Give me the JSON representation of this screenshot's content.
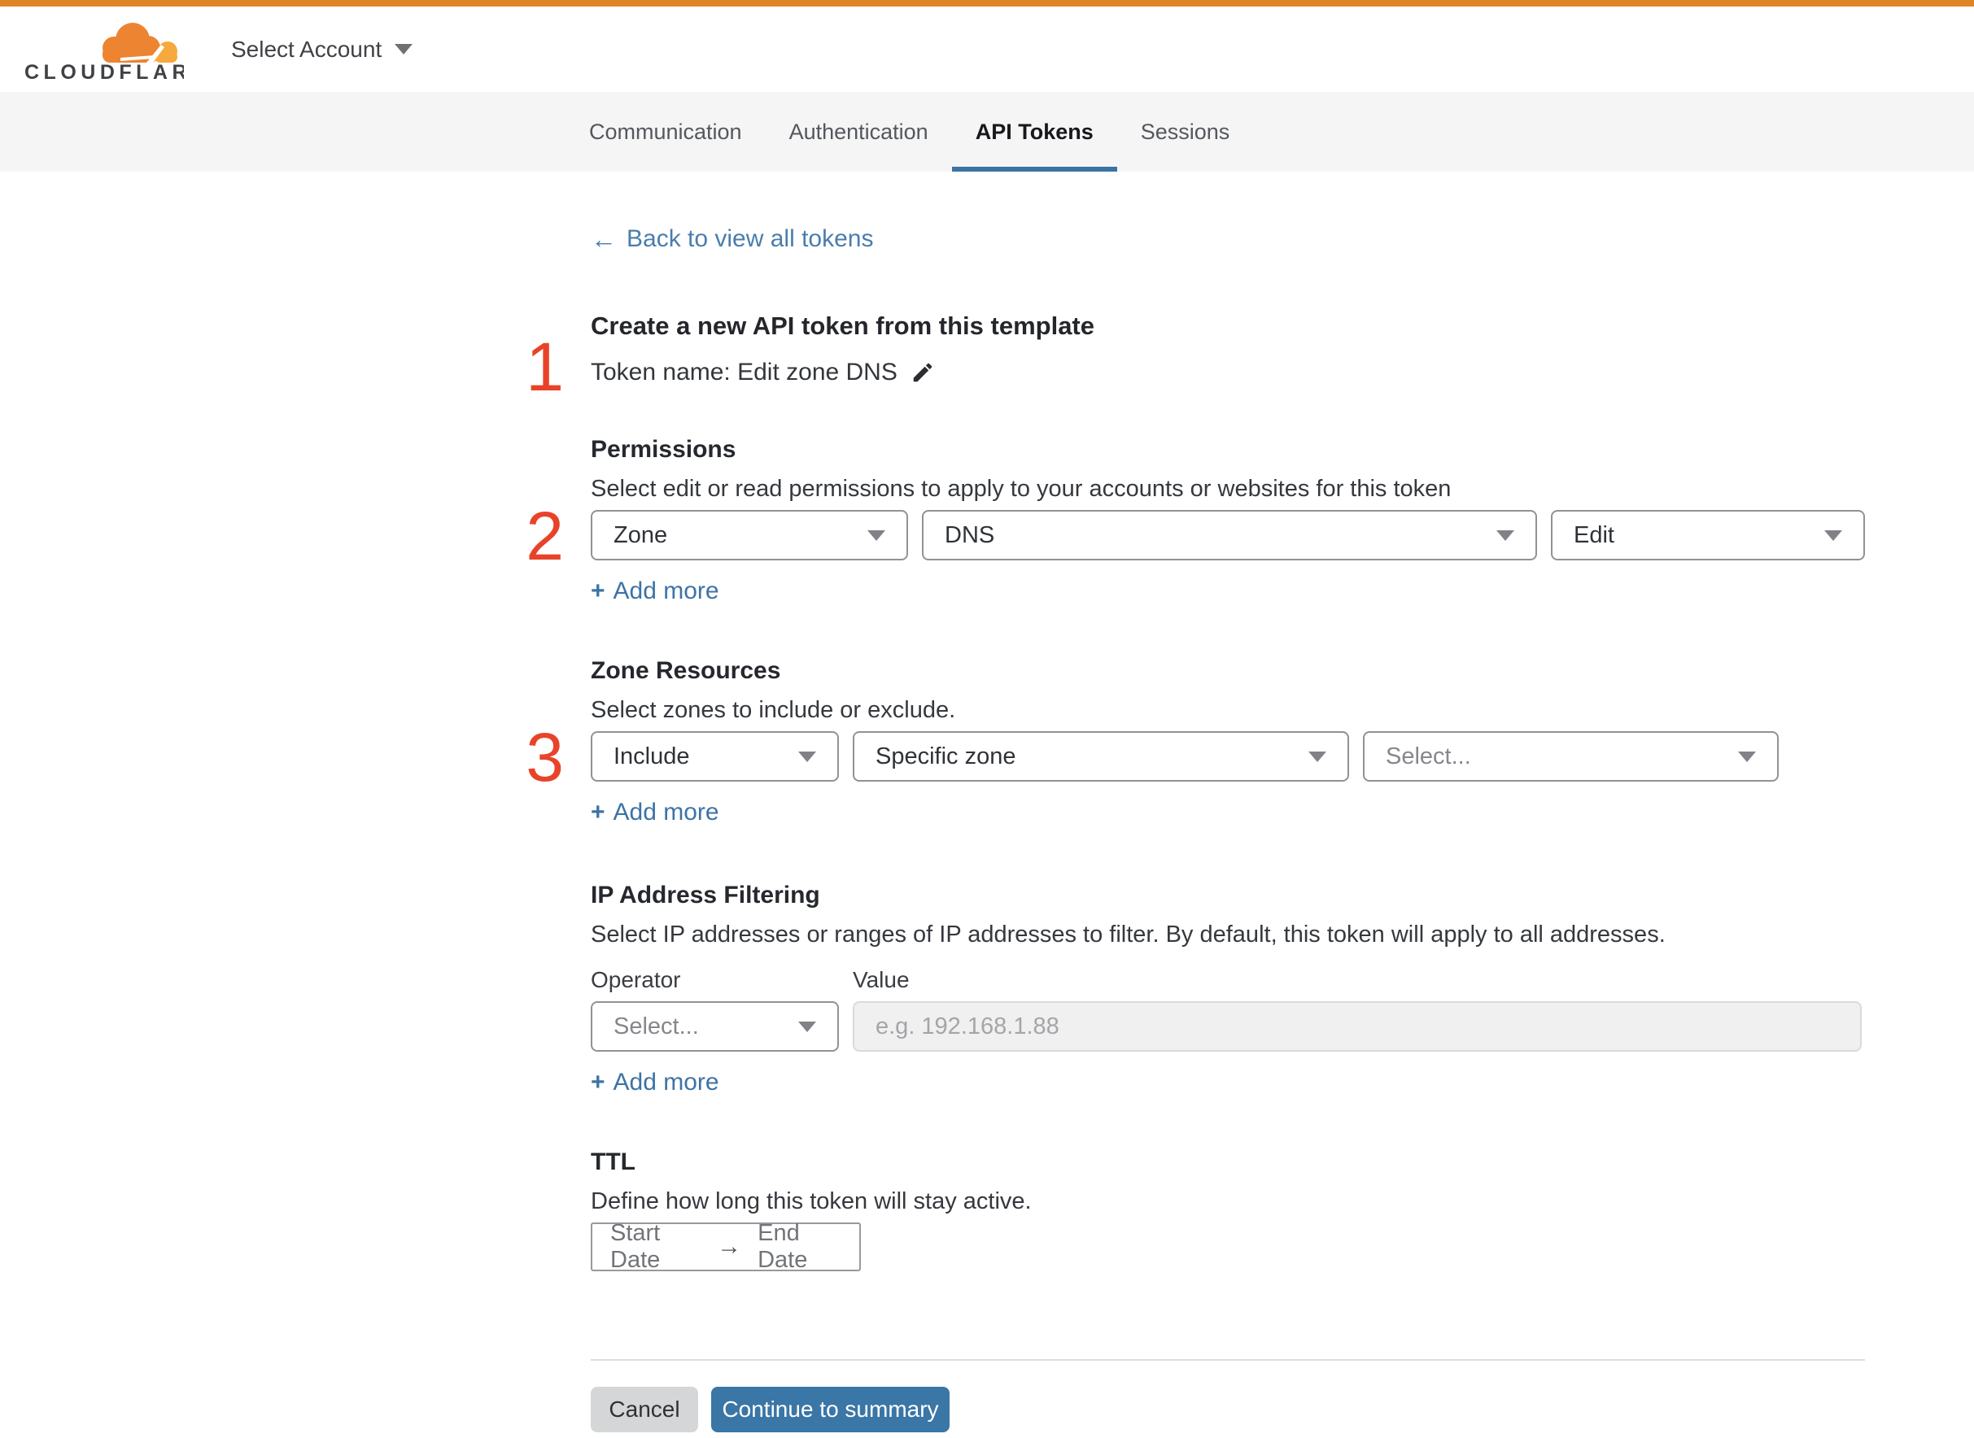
{
  "colors": {
    "top_bar_orange": "#e08526",
    "brand_cloud_orange": "#ed8431",
    "brand_cloud_light": "#f6a93e",
    "step_number_red": "#e8432a",
    "link_blue": "#4a7dac",
    "accent_blue": "#3b73a5",
    "primary_button_blue": "#3a76a6"
  },
  "header": {
    "brand": "CLOUDFLARE",
    "account_selector": "Select Account"
  },
  "nav": {
    "active_tab": "API Tokens",
    "tabs": [
      {
        "label": "Communication"
      },
      {
        "label": "Authentication"
      },
      {
        "label": "API Tokens"
      },
      {
        "label": "Sessions"
      }
    ]
  },
  "back_link": {
    "arrow": "←",
    "label": "Back to view all tokens"
  },
  "token": {
    "step_number": "1",
    "heading": "Create a new API token from this template",
    "name_line": "Token name: Edit zone DNS"
  },
  "permissions": {
    "step_number": "2",
    "heading": "Permissions",
    "description": "Select edit or read permissions to apply to your accounts or websites for this token",
    "selects": [
      {
        "value": "Zone"
      },
      {
        "value": "DNS"
      },
      {
        "value": "Edit"
      }
    ],
    "add_more_plus": "+",
    "add_more_label": "Add more"
  },
  "zone_resources": {
    "step_number": "3",
    "heading": "Zone Resources",
    "description": "Select zones to include or exclude.",
    "selects": [
      {
        "value": "Include"
      },
      {
        "value": "Specific zone"
      },
      {
        "value": "Select..."
      }
    ],
    "add_more_plus": "+",
    "add_more_label": "Add more"
  },
  "ip_filtering": {
    "heading": "IP Address Filtering",
    "description": "Select IP addresses or ranges of IP addresses to filter. By default, this token will apply to all addresses.",
    "operator_label": "Operator",
    "value_label": "Value",
    "operator_select_value": "Select...",
    "value_placeholder": "e.g. 192.168.1.88",
    "add_more_plus": "+",
    "add_more_label": "Add more"
  },
  "ttl": {
    "heading": "TTL",
    "description": "Define how long this token will stay active.",
    "start_date": "Start Date",
    "range_arrow": "→",
    "end_date": "End Date"
  },
  "footer": {
    "cancel": "Cancel",
    "continue": "Continue to summary"
  }
}
